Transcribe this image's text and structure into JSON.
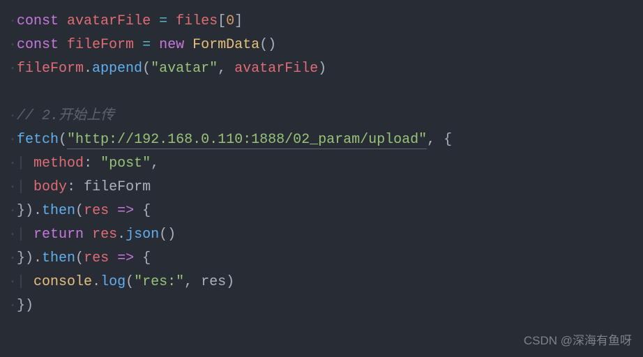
{
  "code": {
    "l1_const": "const",
    "l1_var1": "avatarFile",
    "l1_eq": "=",
    "l1_files": "files",
    "l1_idx": "0",
    "l2_const": "const",
    "l2_var": "fileForm",
    "l2_eq": "=",
    "l2_new": "new",
    "l2_class": "FormData",
    "l3_obj": "fileForm",
    "l3_method": "append",
    "l3_str": "\"avatar\"",
    "l3_arg": "avatarFile",
    "comment": "// 2.开始上传",
    "l5_fetch": "fetch",
    "l5_url": "\"http://192.168.0.110:1888/02_param/upload\"",
    "l6_key": "method",
    "l6_val": "\"post\"",
    "l7_key": "body",
    "l7_val": "fileForm",
    "l8_then": "then",
    "l8_param": "res",
    "l8_arrow": "=>",
    "l9_return": "return",
    "l9_res": "res",
    "l9_json": "json",
    "l10_then": "then",
    "l10_param": "res",
    "l10_arrow": "=>",
    "l11_console": "console",
    "l11_log": "log",
    "l11_str": "\"res:\"",
    "l11_res": "res"
  },
  "watermark": "CSDN @深海有鱼呀"
}
